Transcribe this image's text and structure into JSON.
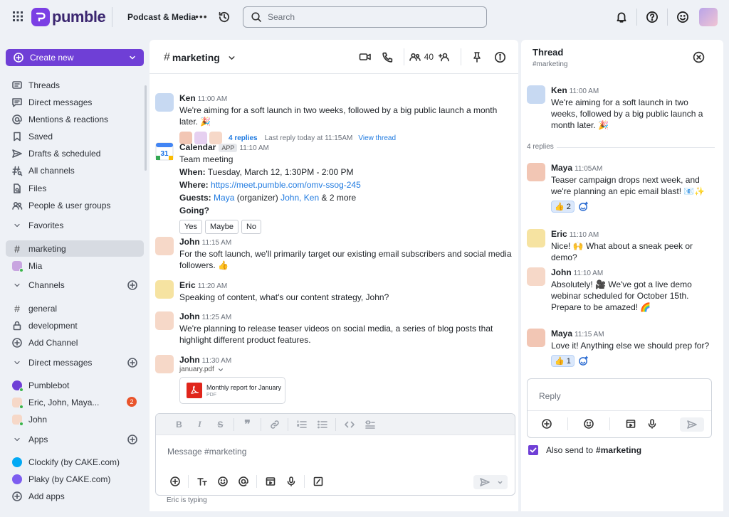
{
  "topbar": {
    "app_name": "pumble",
    "workspace": "Podcast & Media",
    "more": "•••",
    "search_placeholder": "Search"
  },
  "sidebar": {
    "create_label": "Create new",
    "items": {
      "threads": "Threads",
      "direct_messages": "Direct messages",
      "mentions": "Mentions & reactions",
      "saved": "Saved",
      "drafts": "Drafts & scheduled",
      "all_channels": "All channels",
      "files": "Files",
      "people": "People & user groups"
    },
    "favorites_label": "Favorites",
    "favorites": [
      "marketing",
      "Mia"
    ],
    "channels_label": "Channels",
    "channels": [
      "general",
      "development"
    ],
    "add_channel": "Add Channel",
    "dm_label": "Direct messages",
    "dms": [
      "Pumblebot",
      "Eric, John, Maya...",
      "John"
    ],
    "dm_badge": "2",
    "apps_label": "Apps",
    "apps": [
      "Clockify (by CAKE.com)",
      "Plaky (by CAKE.com)"
    ],
    "add_apps": "Add apps"
  },
  "channel": {
    "name": "marketing",
    "member_count": "40"
  },
  "messages": [
    {
      "name": "Ken",
      "time": "11:00 AM",
      "text": "We're aiming for a soft launch in two weeks, followed by a big public launch a month later. 🎉",
      "replies": "4 replies",
      "last_reply": "Last reply today at 11:15AM",
      "view_thread": "View thread"
    },
    {
      "name": "Calendar",
      "tag": "APP",
      "time": "11:10 AM",
      "event": "Team meeting",
      "when_label": "When:",
      "when": "Tuesday, March 12, 1:30PM - 2:00 PM",
      "where_label": "Where:",
      "where": "https://meet.pumble.com/omv-ssog-245",
      "guests_label": "Guests:",
      "guest1": "Maya",
      "guest1_role": "(organizer)",
      "guest2": "John,",
      "guest3": "Ken",
      "guest_more": "& 2 more",
      "going": "Going?",
      "options": [
        "Yes",
        "Maybe",
        "No"
      ]
    },
    {
      "name": "John",
      "time": "11:15 AM",
      "text": "For the soft launch, we'll primarily target our existing email subscribers and social media followers. 👍"
    },
    {
      "name": "Eric",
      "time": "11:20 AM",
      "text": "Speaking of content, what's our content strategy, John?"
    },
    {
      "name": "John",
      "time": "11:25 AM",
      "text": "We're planning to release teaser videos on social media, a series of blog posts that highlight different product features."
    },
    {
      "name": "John",
      "time": "11:30 AM",
      "file_label": "january.pdf",
      "file_name": "Monthly report for January",
      "file_type": "PDF"
    }
  ],
  "composer": {
    "placeholder": "Message #marketing",
    "typing": "Eric is typing"
  },
  "thread": {
    "title": "Thread",
    "channel": "#marketing",
    "parent": {
      "name": "Ken",
      "time": "11:00 AM",
      "text": "We're aiming for a soft launch in two weeks, followed by a big public launch a month later. 🎉"
    },
    "replies_label": "4 replies",
    "replies": [
      {
        "name": "Maya",
        "time": "11:05AM",
        "text": "Teaser campaign drops next week, and we're planning an epic email blast! 📧✨",
        "reaction": "👍",
        "reaction_count": "2"
      },
      {
        "name": "Eric",
        "time": "11:10 AM",
        "text": "Nice! 🙌 What about a sneak peek or demo?"
      },
      {
        "name": "John",
        "time": "11:10 AM",
        "text": "Absolutely! 🎥 We've got a live demo webinar scheduled for October 15th. Prepare to be amazed! 🌈"
      },
      {
        "name": "Maya",
        "time": "11:15 AM",
        "text": "Love it! Anything else we should prep for?",
        "reaction": "👍",
        "reaction_count": "1"
      }
    ],
    "reply_placeholder": "Reply",
    "also_send_label": "Also send to",
    "also_send_channel": "#marketing"
  },
  "colors": {
    "accent": "#6f3fd6",
    "link": "#1f7ae0",
    "badge": "#e9542b",
    "background": "#eef1f6"
  }
}
